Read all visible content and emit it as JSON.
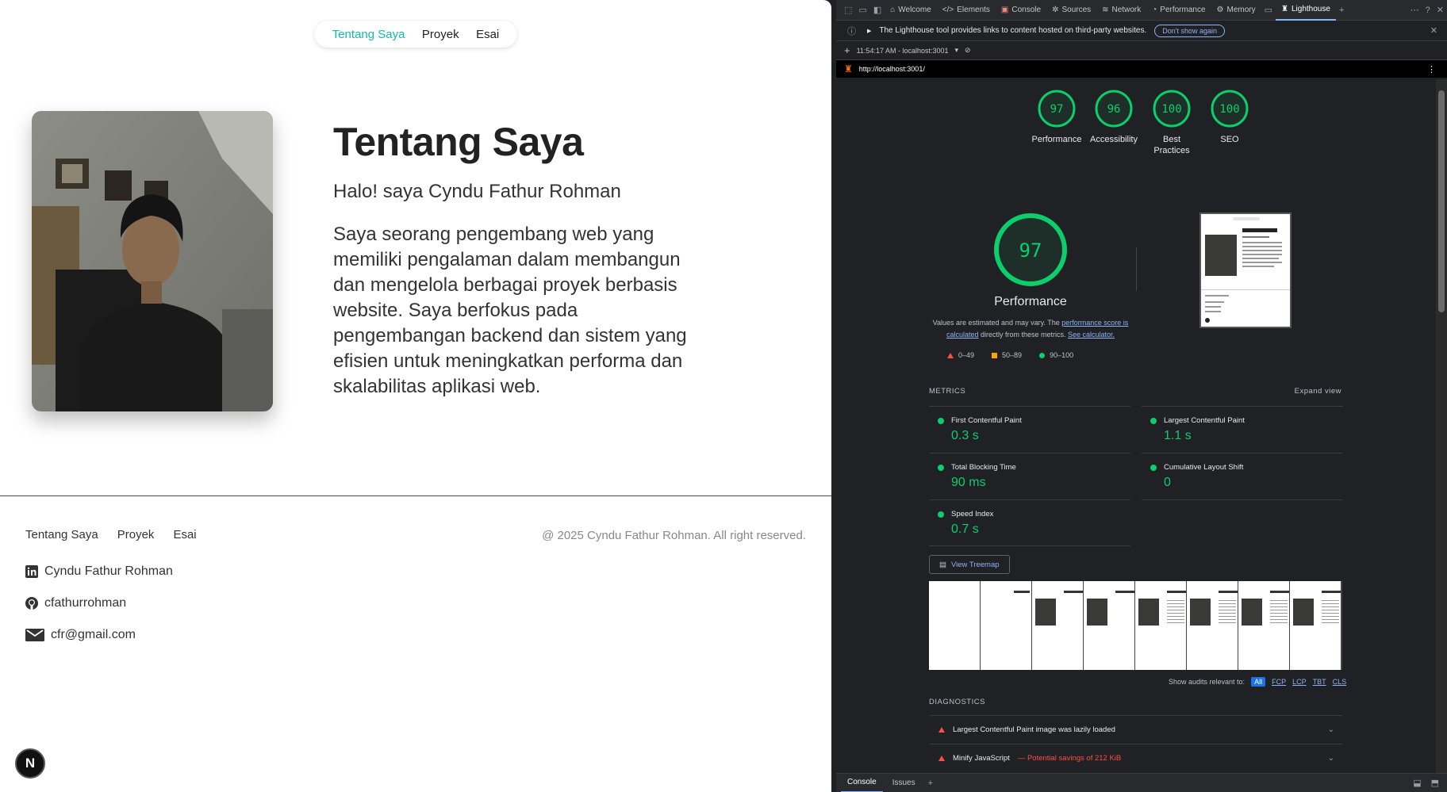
{
  "site": {
    "nav": [
      {
        "label": "Tentang Saya",
        "active": true
      },
      {
        "label": "Proyek",
        "active": false
      },
      {
        "label": "Esai",
        "active": false
      }
    ],
    "title": "Tentang Saya",
    "subtitle": "Halo! saya Cyndu Fathur Rohman",
    "bio_lines": [
      "Saya seorang pengembang web yang",
      "memiliki pengalaman dalam membangun",
      "dan mengelola berbagai proyek berbasis",
      "website. Saya berfokus pada",
      "pengembangan backend dan sistem yang",
      "efisien untuk meningkatkan performa dan",
      "skalabilitas aplikasi web."
    ],
    "footer": {
      "nav": [
        "Tentang Saya",
        "Proyek",
        "Esai"
      ],
      "copyright": "@ 2025 Cyndu Fathur Rohman. All right reserved.",
      "contacts": [
        {
          "icon": "linkedin-icon",
          "text": "Cyndu Fathur Rohman"
        },
        {
          "icon": "github-icon",
          "text": "cfathurrohman"
        },
        {
          "icon": "mail-icon",
          "text": "cfr@gmail.com"
        }
      ]
    },
    "next_badge": "N"
  },
  "devtools": {
    "tabs": [
      "Welcome",
      "Elements",
      "Console",
      "Sources",
      "Network",
      "Performance",
      "Memory",
      "Lighthouse"
    ],
    "active_tab": "Lighthouse",
    "notice": "The Lighthouse tool provides links to content hosted on third-party websites.",
    "notice_button": "Don't show again",
    "report_label": "11:54:17 AM - localhost:3001",
    "url": "http://localhost:3001/",
    "scores": [
      {
        "value": 97,
        "label": "Performance"
      },
      {
        "value": 96,
        "label": "Accessibility"
      },
      {
        "value": 100,
        "label": "Best Practices"
      },
      {
        "value": 100,
        "label": "SEO"
      }
    ],
    "big_score": 97,
    "big_label": "Performance",
    "note_prefix": "Values are estimated and may vary. The ",
    "note_link1": "performance score is calculated",
    "note_mid": " directly from these metrics. ",
    "note_link2": "See calculator.",
    "legend": [
      "0–49",
      "50–89",
      "90–100"
    ],
    "metrics_title": "METRICS",
    "expand_view": "Expand view",
    "metrics": [
      {
        "name": "First Contentful Paint",
        "value": "0.3 s"
      },
      {
        "name": "Largest Contentful Paint",
        "value": "1.1 s"
      },
      {
        "name": "Total Blocking Time",
        "value": "90 ms"
      },
      {
        "name": "Cumulative Layout Shift",
        "value": "0"
      },
      {
        "name": "Speed Index",
        "value": "0.7 s"
      }
    ],
    "treemap": "View Treemap",
    "audits_label": "Show audits relevant to:",
    "audit_filters": [
      "All",
      "FCP",
      "LCP",
      "TBT",
      "CLS"
    ],
    "diagnostics_title": "DIAGNOSTICS",
    "diagnostics": [
      {
        "text": "Largest Contentful Paint image was lazily loaded",
        "savings": ""
      },
      {
        "text": "Minify JavaScript",
        "savings": "— Potential savings of 212 KiB"
      }
    ],
    "drawer_tabs": [
      "Console",
      "Issues"
    ],
    "colors": {
      "pass": "#0cce6b",
      "average": "#ffa400",
      "fail": "#ff4e42",
      "accent": "#14b8a6"
    }
  }
}
